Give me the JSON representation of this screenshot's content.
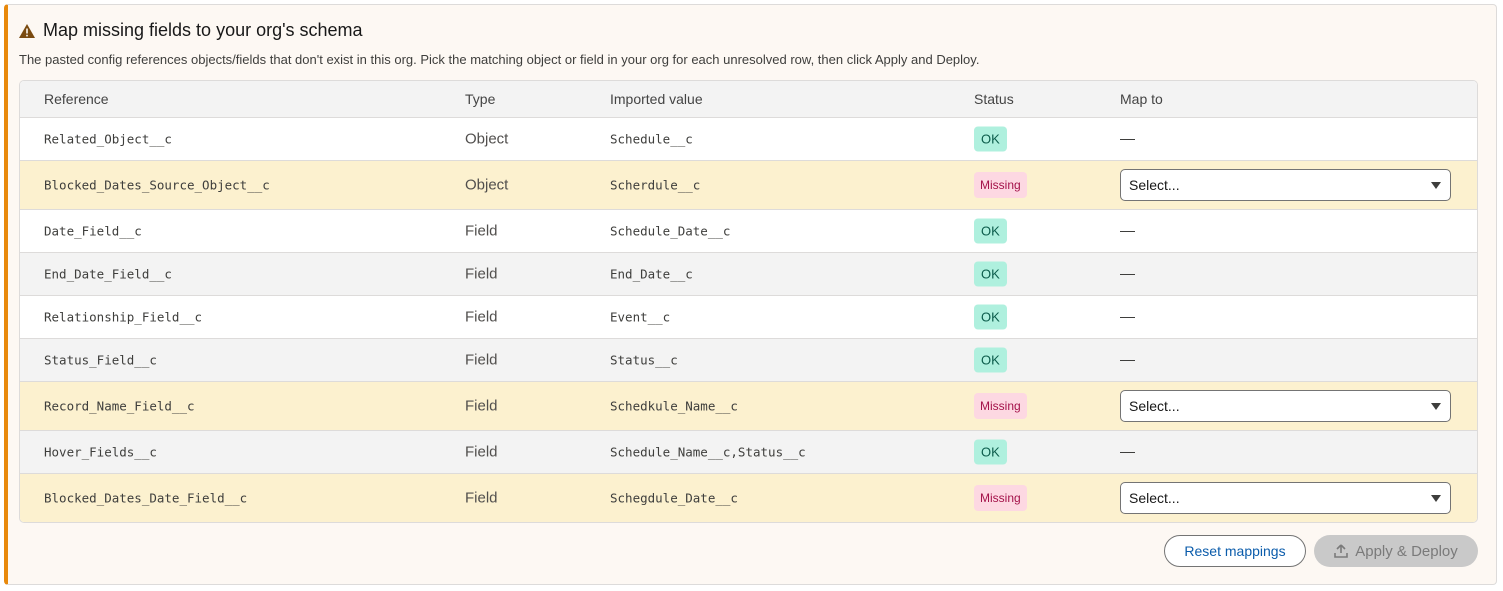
{
  "header": {
    "title": "Map missing fields to your org's schema",
    "description": "The pasted config references objects/fields that don't exist in this org. Pick the matching object or field in your org for each unresolved row, then click Apply and Deploy.",
    "icon": "warning-icon",
    "accent_color": "#e8890c"
  },
  "table": {
    "columns": [
      "Reference",
      "Type",
      "Imported value",
      "Status",
      "Map to"
    ],
    "rows": [
      {
        "reference": "Related_Object__c",
        "type": "Object",
        "imported": "Schedule__c",
        "status": "OK",
        "map": "—"
      },
      {
        "reference": "Blocked_Dates_Source_Object__c",
        "type": "Object",
        "imported": "Scherdule__c",
        "status": "Missing",
        "map": "Select..."
      },
      {
        "reference": "Date_Field__c",
        "type": "Field",
        "imported": "Schedule_Date__c",
        "status": "OK",
        "map": "—"
      },
      {
        "reference": "End_Date_Field__c",
        "type": "Field",
        "imported": "End_Date__c",
        "status": "OK",
        "map": "—"
      },
      {
        "reference": "Relationship_Field__c",
        "type": "Field",
        "imported": "Event__c",
        "status": "OK",
        "map": "—"
      },
      {
        "reference": "Status_Field__c",
        "type": "Field",
        "imported": "Status__c",
        "status": "OK",
        "map": "—"
      },
      {
        "reference": "Record_Name_Field__c",
        "type": "Field",
        "imported": "Schedkule_Name__c",
        "status": "Missing",
        "map": "Select..."
      },
      {
        "reference": "Hover_Fields__c",
        "type": "Field",
        "imported": "Schedule_Name__c,Status__c",
        "status": "OK",
        "map": "—"
      },
      {
        "reference": "Blocked_Dates_Date_Field__c",
        "type": "Field",
        "imported": "Schegdule_Date__c",
        "status": "Missing",
        "map": "Select..."
      }
    ]
  },
  "actions": {
    "reset_label": "Reset mappings",
    "apply_label": "Apply & Deploy",
    "apply_icon": "upload-icon"
  },
  "colors": {
    "ok_bg": "#aff0de",
    "missing_bg": "#fdd8e2",
    "missing_row_bg": "#fcf1cf",
    "link": "#0b5cab"
  }
}
